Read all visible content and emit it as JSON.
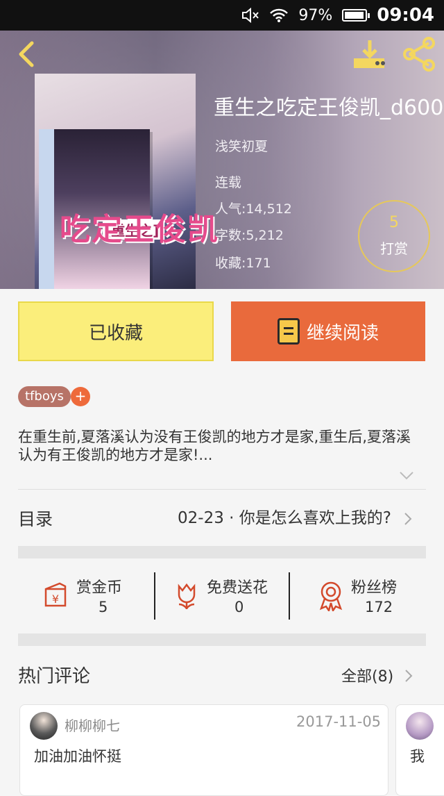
{
  "status_bar": {
    "battery": "97%",
    "battery_level": 0.97,
    "time": "09:04"
  },
  "header": {
    "back_icon": "back-arrow-icon",
    "download_icon": "download-icon",
    "share_icon": "share-icon",
    "accent": "#f4d75f"
  },
  "book": {
    "cover_title": "吃定王俊凯",
    "cover_subtitle": "[重生之]",
    "title": "重生之吃定王俊凯_d600",
    "author": "浅笑初夏",
    "status": "连载",
    "popularity": "人气:14,512",
    "word_count": "字数:5,212",
    "favorites": "收藏:171"
  },
  "reward": {
    "count": "5",
    "label": "打赏"
  },
  "actions": {
    "favorited_label": "已收藏",
    "continue_label": "继续阅读",
    "continue_color": "#e96a3c",
    "favorited_color": "#fbee7b"
  },
  "tags": {
    "items": [
      "tfboys"
    ],
    "add": "+"
  },
  "synopsis": "在重生前,夏落溪认为没有王俊凯的地方才是家,重生后,夏落溪认为有王俊凯的地方才是家!...",
  "toc": {
    "label": "目录",
    "latest": "02-23 · 你是怎么喜欢上我的?"
  },
  "stats": [
    {
      "icon": "red-envelope-icon",
      "label": "赏金币",
      "value": "5"
    },
    {
      "icon": "flower-icon",
      "label": "免费送花",
      "value": "0"
    },
    {
      "icon": "ribbon-badge-icon",
      "label": "粉丝榜",
      "value": "172"
    }
  ],
  "comments": {
    "title": "热门评论",
    "all_label": "全部(8)",
    "items": [
      {
        "user": "柳柳柳七",
        "date": "2017-11-05",
        "text": "加油加油怀挺"
      },
      {
        "user": "",
        "date": "",
        "text": "我"
      }
    ]
  }
}
